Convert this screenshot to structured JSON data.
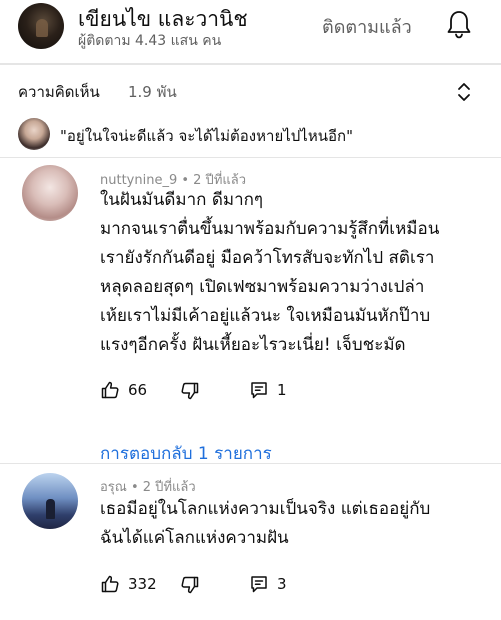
{
  "channel": {
    "name": "เขียนไข และวานิช",
    "subscribers": "ผู้ติดตาม 4.43 แสน คน",
    "subscribe_label": "ติดตามแล้ว",
    "bell_icon": "bell-icon"
  },
  "comments_header": {
    "label": "ความคิดเห็น",
    "count": "1.9 พัน",
    "sort_icon": "sort-icon"
  },
  "pinned": {
    "text": "\"อยู่ในใจน่ะดีแล้ว จะได้ไม่ต้องหายไปไหนอีก\""
  },
  "comments": [
    {
      "author": "nuttynine_9 • 2 ปีที่แล้ว",
      "lines": [
        "ในฝันมันดีมาก ดีมากๆ",
        "มากจนเราตื่นขึ้นมาพร้อมกับความรู้สึกที่เหมือน",
        "เรายังรักกันดีอยู่ มือคว้าโทรสับจะทักไป  สติเรา",
        "หลุดลอยสุดๆ เปิดเฟซมาพร้อมความว่างเปล่า",
        "เห้ยเราไม่มีเค้าอยู่แล้วนะ ใจเหมือนมันหักป๊าบ",
        "แรงๆอีกครั้ง ฝันเหี้ยอะไรวะเนี่ย! เจ็บชะมัด"
      ],
      "likes": "66",
      "replies": "1"
    },
    {
      "author": "อรุณ • 2 ปีที่แล้ว",
      "lines": [
        "เธอมีอยู่ในโลกแห่งความเป็นจริง แต่เธออยู่กับ",
        "ฉันได้แค่โลกแห่งความฝัน"
      ],
      "likes": "332",
      "replies": "3"
    }
  ],
  "replies_link": "การตอบกลับ 1 รายการ",
  "colors": {
    "link": "#1f6fdc",
    "secondary_text": "#606060",
    "primary_text": "#0f0f0f"
  }
}
